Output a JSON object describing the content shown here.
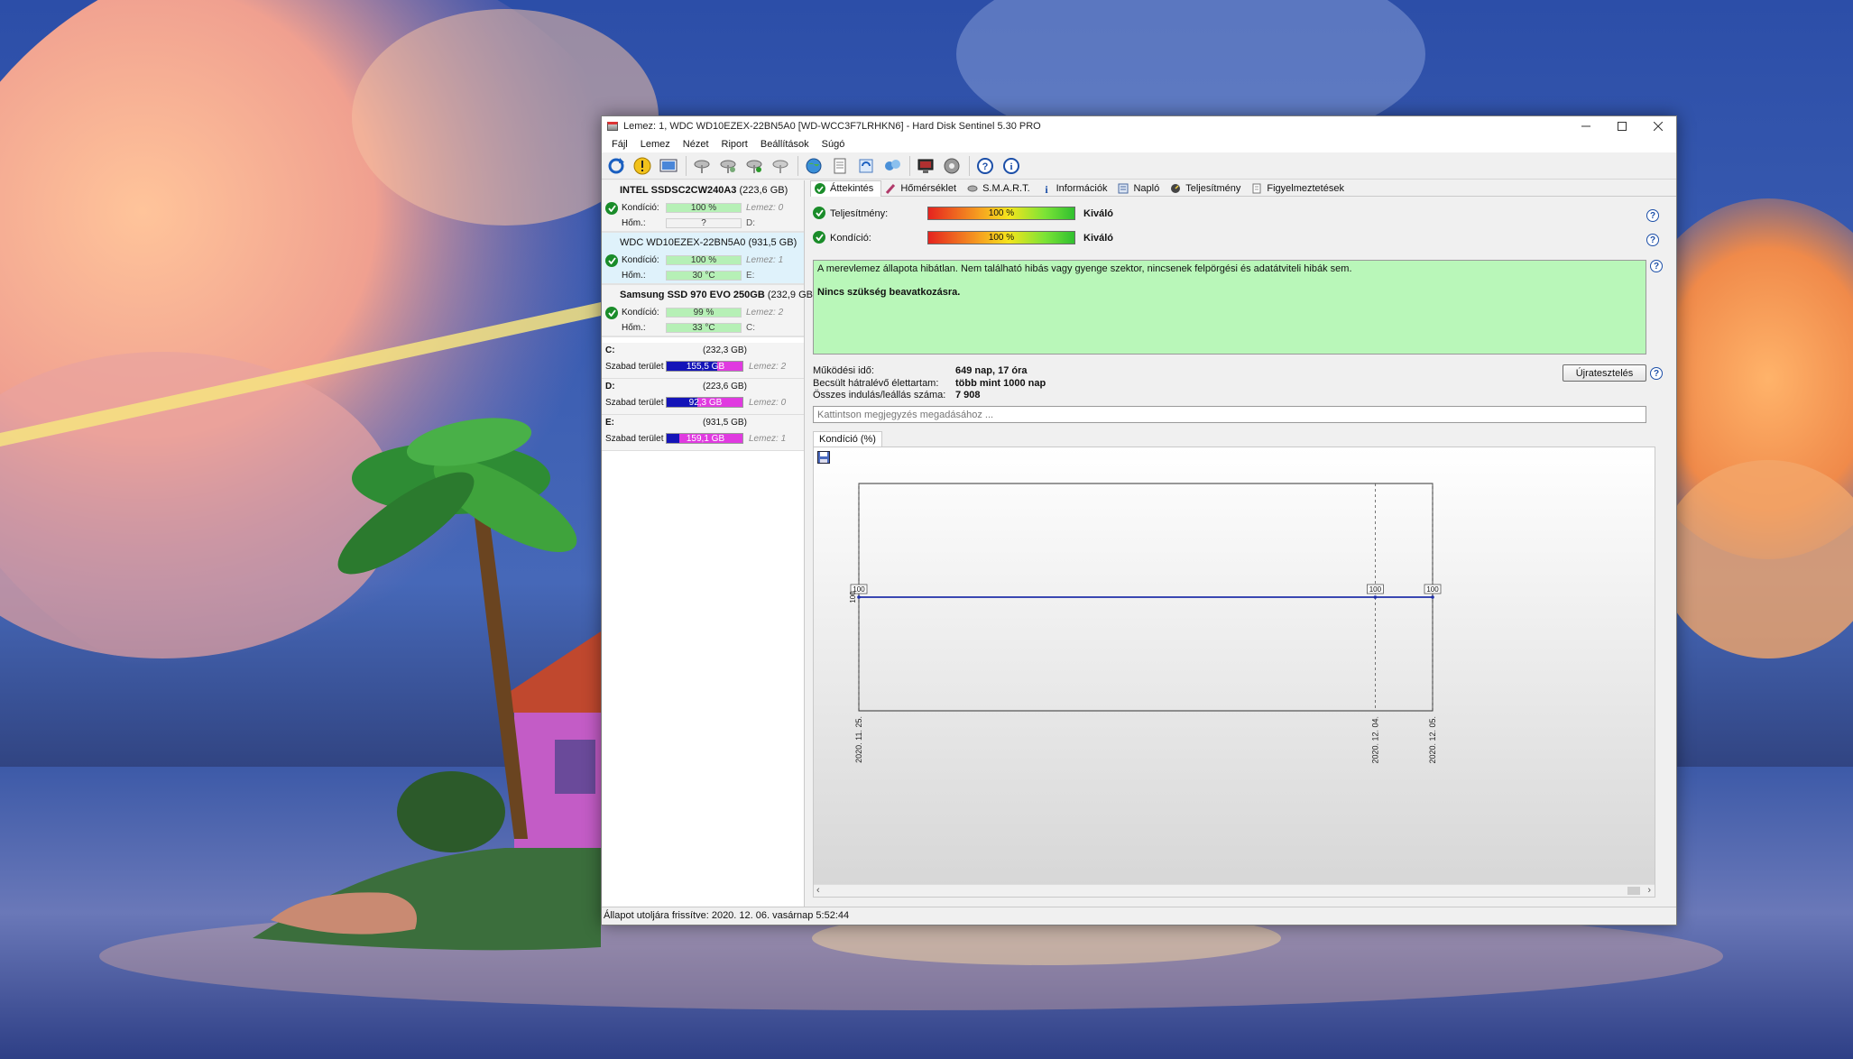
{
  "window": {
    "title": "Lemez: 1, WDC WD10EZEX-22BN5A0 [WD-WCC3F7LRHKN6]  -  Hard Disk Sentinel 5.30 PRO"
  },
  "menu": [
    "Fájl",
    "Lemez",
    "Nézet",
    "Riport",
    "Beállítások",
    "Súgó"
  ],
  "disks": [
    {
      "name": "INTEL SSDSC2CW240A3",
      "size": "(223,6 GB)",
      "health_label": "Kondíció:",
      "health": "100 %",
      "disk_ref": "Lemez: 0",
      "temp_label": "Hőm.:",
      "temp": "?",
      "drive": "D:"
    },
    {
      "name": "WDC WD10EZEX-22BN5A0",
      "size": "(931,5 GB)",
      "health_label": "Kondíció:",
      "health": "100 %",
      "disk_ref": "Lemez: 1",
      "temp_label": "Hőm.:",
      "temp": "30 °C",
      "drive": "E:"
    },
    {
      "name": "Samsung SSD 970 EVO 250GB",
      "size": "(232,9 GB)",
      "health_label": "Kondíció:",
      "health": "99 %",
      "disk_ref": "Lemez: 2",
      "temp_label": "Hőm.:",
      "temp": "33 °C",
      "drive": "C:"
    }
  ],
  "volumes": [
    {
      "letter": "C:",
      "size": "(232,3 GB)",
      "free_label": "Szabad terület",
      "free": "155,5 GB",
      "free_fraction": 0.67,
      "disk_ref": "Lemez: 2"
    },
    {
      "letter": "D:",
      "size": "(223,6 GB)",
      "free_label": "Szabad terület",
      "free": "92,3 GB",
      "free_fraction": 0.41,
      "disk_ref": "Lemez: 0"
    },
    {
      "letter": "E:",
      "size": "(931,5 GB)",
      "free_label": "Szabad terület",
      "free": "159,1 GB",
      "free_fraction": 0.17,
      "disk_ref": "Lemez: 1"
    }
  ],
  "tabs": [
    "Áttekintés",
    "Hőmérséklet",
    "S.M.A.R.T.",
    "Információk",
    "Napló",
    "Teljesítmény",
    "Figyelmeztetések"
  ],
  "overview": {
    "performance_label": "Teljesítmény:",
    "performance_value": "100 %",
    "performance_rating": "Kiváló",
    "health_label": "Kondíció:",
    "health_value": "100 %",
    "health_rating": "Kiváló",
    "status_text": "A merevlemez állapota hibátlan. Nem található hibás vagy gyenge szektor, nincsenek felpörgési és adatátviteli hibák sem.",
    "status_action": "Nincs szükség beavatkozásra.",
    "power_on_label": "Működési idő:",
    "power_on_value": "649 nap, 17 óra",
    "lifetime_label": "Becsült hátralévő élettartam:",
    "lifetime_value": "több mint 1000 nap",
    "startstop_label": "Összes indulás/leállás száma:",
    "startstop_value": "7 908",
    "retest_button": "Újratesztelés",
    "note_placeholder": "Kattintson megjegyzés megadásához ..."
  },
  "chart_tab": "Kondíció  (%)",
  "chart_data": {
    "type": "line",
    "x": [
      "2020. 11. 25.",
      "2020. 12. 04.",
      "2020. 12. 05."
    ],
    "x_days": [
      0,
      9,
      10
    ],
    "series": [
      {
        "name": "Kondíció (%)",
        "values": [
          100,
          100,
          100
        ]
      }
    ],
    "y_tick": "100",
    "color": "#1f2fa8"
  },
  "statusbar": "Állapot utoljára frissítve: 2020. 12. 06. vasárnap 5:52:44",
  "colors": {
    "healthy_bg": "#b9f7b9",
    "volume_free": "#1414b8",
    "volume_used": "#e03ae0",
    "check": "#1a8c2a",
    "accent": "#1c4fa8"
  }
}
